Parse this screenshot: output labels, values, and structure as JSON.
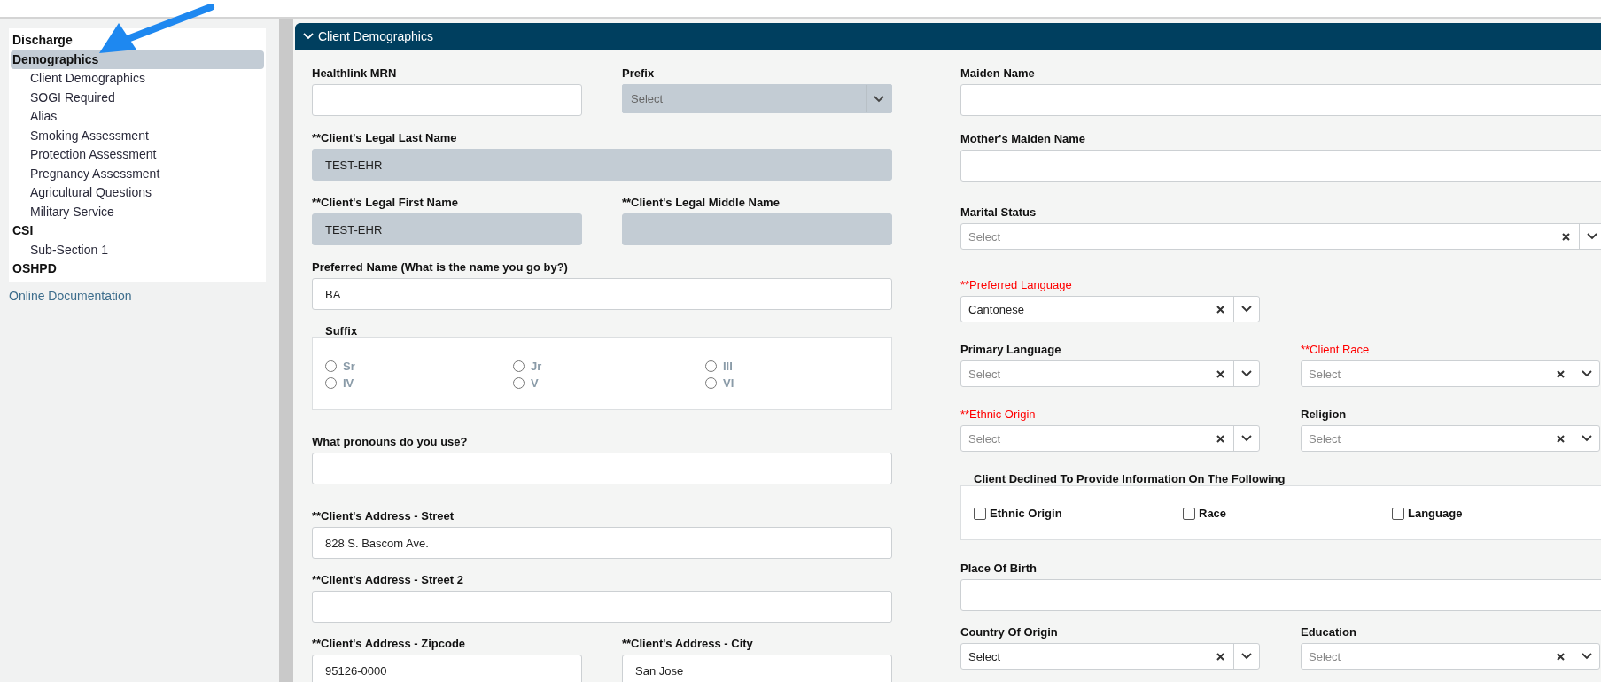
{
  "sidebar": {
    "items": [
      {
        "label": "Discharge",
        "selected": false
      },
      {
        "label": "Demographics",
        "selected": true,
        "children": [
          {
            "label": "Client Demographics",
            "selected": false
          },
          {
            "label": "SOGI Required",
            "selected": false
          },
          {
            "label": "Alias",
            "selected": false
          },
          {
            "label": "Smoking Assessment",
            "selected": false
          },
          {
            "label": "Protection Assessment",
            "selected": false
          },
          {
            "label": "Pregnancy Assessment",
            "selected": false
          },
          {
            "label": "Agricultural Questions",
            "selected": false
          },
          {
            "label": "Military Service",
            "selected": false
          }
        ]
      },
      {
        "label": "CSI",
        "selected": false,
        "children": [
          {
            "label": "Sub-Section 1",
            "selected": false
          }
        ]
      },
      {
        "label": "OSHPD",
        "selected": false
      }
    ],
    "link": "Online Documentation"
  },
  "section": {
    "title": "Client Demographics",
    "expanded": true,
    "left_column": [
      {
        "fields": [
          {
            "kind": "text",
            "label": "Healthlink MRN",
            "disabled": false,
            "emphasized": false
          },
          {
            "kind": "select",
            "label": "Prefix",
            "placeholder": "Select",
            "disabled": true,
            "emphasized": false
          }
        ]
      },
      {
        "fields": [
          {
            "kind": "text",
            "label": "**Client's Legal Last Name",
            "value": "TEST-EHR",
            "disabled": true,
            "emphasized": false
          }
        ]
      },
      {
        "fields": [
          {
            "kind": "text",
            "label": "**Client's Legal First Name",
            "value": "TEST-EHR",
            "disabled": true,
            "emphasized": false
          },
          {
            "kind": "text",
            "label": "**Client's Legal Middle Name",
            "disabled": true,
            "emphasized": false
          }
        ]
      },
      {
        "fields": [
          {
            "kind": "text",
            "label": "Preferred Name (What is the name you go by?)",
            "value": "BA",
            "disabled": false,
            "emphasized": false
          }
        ]
      },
      {
        "fields": [
          {
            "kind": "radios",
            "label": "Suffix",
            "emphasized": false,
            "options": [
              {
                "label": "Sr",
                "selected": false,
                "disabled": true
              },
              {
                "label": "Jr",
                "selected": false,
                "disabled": true
              },
              {
                "label": "III",
                "selected": false,
                "disabled": true
              },
              {
                "label": "IV",
                "selected": false,
                "disabled": true
              },
              {
                "label": "V",
                "selected": false,
                "disabled": true
              },
              {
                "label": "VI",
                "selected": false,
                "disabled": true
              }
            ]
          }
        ]
      },
      {
        "fields": [
          {
            "kind": "text",
            "label": "What pronouns do you use?",
            "disabled": false,
            "emphasized": false
          }
        ]
      },
      {
        "fields": [
          {
            "kind": "text",
            "label": "**Client's Address - Street",
            "value": "828 S. Bascom Ave.",
            "disabled": false,
            "emphasized": false
          }
        ]
      },
      {
        "fields": [
          {
            "kind": "text",
            "label": "**Client's Address - Street 2",
            "disabled": false,
            "emphasized": false
          }
        ]
      },
      {
        "fields": [
          {
            "kind": "text",
            "label": "**Client's Address - Zipcode",
            "value": "95126-0000",
            "disabled": false,
            "emphasized": false
          },
          {
            "kind": "text",
            "label": "**Client's Address - City",
            "value": "San Jose",
            "disabled": false,
            "emphasized": false
          }
        ]
      }
    ],
    "right_column": [
      {
        "fields": [
          {
            "kind": "text",
            "label": "Maiden Name",
            "disabled": false,
            "emphasized": false
          }
        ]
      },
      {
        "fields": [
          {
            "kind": "text",
            "label": "Mother's Maiden Name",
            "disabled": false,
            "emphasized": false
          }
        ]
      },
      {
        "fields": [
          {
            "kind": "combo",
            "label": "Marital Status",
            "placeholder": "Select",
            "disabled": false,
            "emphasized": false
          }
        ]
      },
      {
        "fields": [
          {
            "kind": "combo",
            "label": "**Preferred Language",
            "value": "Cantonese",
            "disabled": false,
            "emphasized": true
          }
        ]
      },
      {
        "fields": [
          {
            "kind": "combo",
            "label": "Primary Language",
            "placeholder": "Select",
            "disabled": false,
            "emphasized": false
          },
          {
            "kind": "combo",
            "label": "**Client Race",
            "placeholder": "Select",
            "disabled": false,
            "emphasized": true
          }
        ]
      },
      {
        "fields": [
          {
            "kind": "combo",
            "label": "**Ethnic Origin",
            "placeholder": "Select",
            "disabled": false,
            "emphasized": true
          },
          {
            "kind": "combo",
            "label": "Religion",
            "placeholder": "Select",
            "disabled": false,
            "emphasized": false
          }
        ]
      },
      {
        "fields": [
          {
            "kind": "checkboxes",
            "label": "Client Declined To Provide Information On The Following",
            "emphasized": false,
            "options": [
              {
                "label": "Ethnic Origin",
                "checked": false
              },
              {
                "label": "Race",
                "checked": false
              },
              {
                "label": "Language",
                "checked": false
              }
            ]
          }
        ]
      },
      {
        "fields": [
          {
            "kind": "text",
            "label": "Place Of Birth",
            "disabled": false,
            "emphasized": false
          }
        ]
      },
      {
        "fields": [
          {
            "kind": "combo",
            "label": "Country Of Origin",
            "value": "Select",
            "disabled": false,
            "emphasized": false
          },
          {
            "kind": "combo",
            "label": "Education",
            "placeholder": "Select",
            "disabled": false,
            "emphasized": false
          }
        ]
      }
    ]
  }
}
